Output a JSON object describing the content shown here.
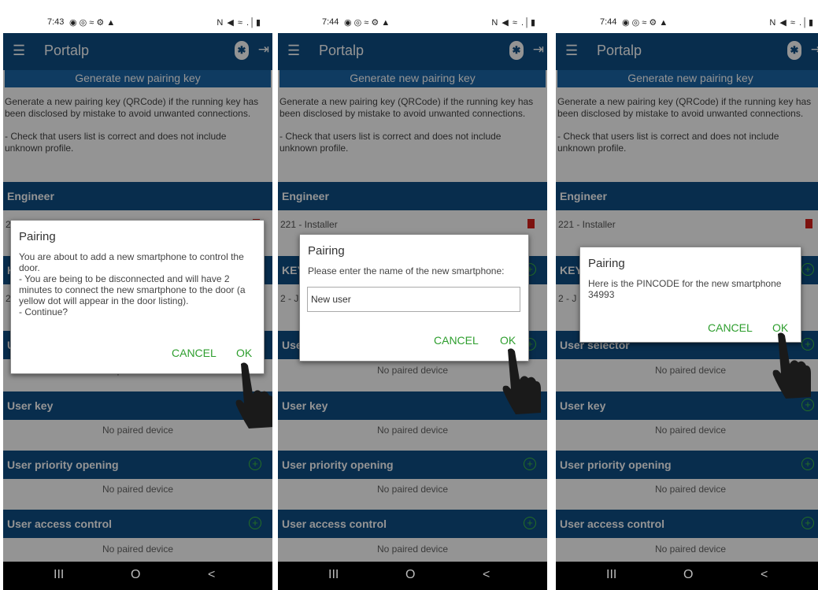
{
  "app": {
    "title": "Portalp",
    "menu_icon": "menu-icon",
    "bluetooth_icon": "bluetooth-icon",
    "logout_icon": "logout-icon"
  },
  "status": {
    "time1": "7:43",
    "time2": "7:44",
    "time3": "7:44",
    "icons_left": "◉ ◎ ≈ ⚙ ▲",
    "icons_right": "N ◀ ≈ .│▮"
  },
  "generate_button": "Generate new pairing key",
  "description": {
    "p1": "Generate a new pairing key (QRCode) if the running key has been disclosed by mistake to avoid unwanted connections.",
    "p2": "- Check that users list is correct and does not include unknown profile."
  },
  "sections": {
    "engineer": "Engineer",
    "key": "KEY",
    "user_selector": "User selector",
    "user_key": "User key",
    "user_priority": "User priority opening",
    "user_access": "User access control"
  },
  "devices": {
    "installer": "221 - Installer",
    "key_fragment": "2 - J",
    "no_paired": "No paired device"
  },
  "dialog1": {
    "title": "Pairing",
    "message": "You are about to add a new smartphone to control the door.\n- You are being to be disconnected and will have 2 minutes to connect the new smartphone to the door (a yellow dot will appear in the door listing).\n- Continue?",
    "cancel": "CANCEL",
    "ok": "OK"
  },
  "dialog2": {
    "title": "Pairing",
    "message": "Please enter the name of the new smartphone:",
    "input_value": "New user",
    "cancel": "CANCEL",
    "ok": "OK"
  },
  "dialog3": {
    "title": "Pairing",
    "message": "Here is the PINCODE for the new smartphone\n34993",
    "cancel": "CANCEL",
    "ok": "OK"
  },
  "nav": {
    "recents": "III",
    "home": "O",
    "back": "<"
  },
  "colors": {
    "appbar": "#0f4e86",
    "section": "#0f4e86",
    "button_green": "#2e9e2e",
    "trash_red": "#d8201a"
  }
}
